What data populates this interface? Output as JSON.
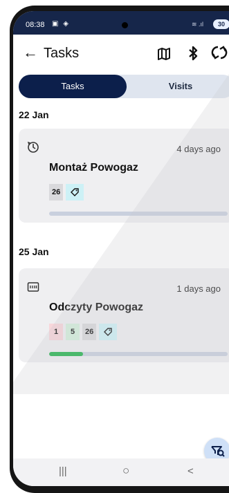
{
  "status_bar": {
    "time": "08:38",
    "battery": "30"
  },
  "app_bar": {
    "title": "Tasks",
    "back_icon": "arrow-left-icon",
    "map_icon": "map-icon",
    "bluetooth_icon": "bluetooth-icon",
    "sync_icon": "sync-icon"
  },
  "tabs": [
    {
      "label": "Tasks",
      "active": true
    },
    {
      "label": "Visits",
      "active": false
    }
  ],
  "groups": [
    {
      "date": "22 Jan",
      "task": {
        "icon": "clock-refresh-icon",
        "ago": "4 days ago",
        "title": "Montaż Powogaz",
        "count": "26",
        "progress": 0
      }
    },
    {
      "date": "25 Jan",
      "task": {
        "icon": "meter-icon",
        "ago": "1 days ago",
        "title": "Odczyty Powogaz",
        "count_red": "1",
        "count_green": "5",
        "count": "26",
        "progress": 0.2
      }
    }
  ],
  "colors": {
    "primary": "#0c1f4b",
    "progress_track": "#c9d0de",
    "progress_fill": "#21b24a",
    "fab": "#cfe0f7"
  },
  "fab_icon": "filter-search-icon",
  "nav": {
    "recents": "|||",
    "home": "○",
    "back": "<"
  }
}
